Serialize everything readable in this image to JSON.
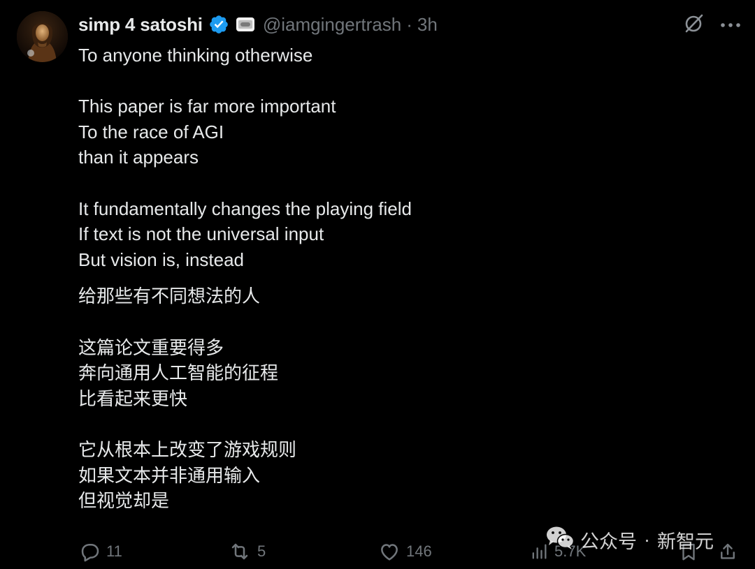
{
  "tweet": {
    "author": {
      "display_name": "simp 4 satoshi",
      "handle": "@iamgingertrash",
      "verified": true,
      "avatar_icon": "avatar-portrait"
    },
    "separator": "·",
    "time": "3h",
    "paragraphs": [
      {
        "lines": [
          "To anyone thinking otherwise"
        ]
      },
      {
        "lines": [
          "This paper is far more important",
          "To the race of AGI",
          "than it appears"
        ]
      },
      {
        "lines": [
          "It fundamentally changes the playing field",
          "If text is not the universal input",
          "But vision is, instead"
        ]
      },
      {
        "lines": [
          "给那些有不同想法的人"
        ]
      },
      {
        "lines": [
          "这篇论文重要得多",
          "奔向通用人工智能的征程",
          "比看起来更快"
        ]
      },
      {
        "lines": [
          "它从根本上改变了游戏规则",
          "如果文本并非通用输入",
          "但视觉却是"
        ]
      }
    ],
    "actions": {
      "replies": "11",
      "reposts": "5",
      "likes": "146",
      "views": "5.7K"
    }
  },
  "watermark": {
    "source": "公众号",
    "separator": "·",
    "account": "新智元"
  },
  "colors": {
    "background": "#000000",
    "text": "#e7e9ea",
    "muted": "#71767b",
    "verified": "#1d9bf0"
  },
  "icons": {
    "header": [
      "grok-icon",
      "more-icon"
    ],
    "footer": [
      "reply-icon",
      "repost-icon",
      "like-icon",
      "views-icon",
      "bookmark-icon",
      "share-icon"
    ]
  }
}
